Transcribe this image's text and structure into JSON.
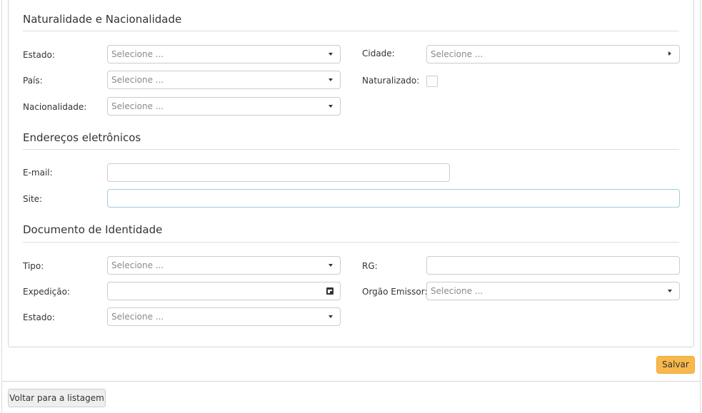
{
  "naturalidade": {
    "title": "Naturalidade e Nacionalidade",
    "estado": {
      "label": "Estado:",
      "placeholder": "Selecione ..."
    },
    "pais": {
      "label": "País:",
      "placeholder": "Selecione ..."
    },
    "nacionalidade": {
      "label": "Nacionalidade:",
      "placeholder": "Selecione ..."
    },
    "cidade": {
      "label": "Cidade:",
      "placeholder": "Selecione ..."
    },
    "naturalizado": {
      "label": "Naturalizado:",
      "checked": false
    }
  },
  "enderecos": {
    "title": "Endereços eletrônicos",
    "email": {
      "label": "E-mail:",
      "value": ""
    },
    "site": {
      "label": "Site:",
      "value": ""
    }
  },
  "documento": {
    "title": "Documento de Identidade",
    "tipo": {
      "label": "Tipo:",
      "placeholder": "Selecione ..."
    },
    "expedicao": {
      "label": "Expedição:",
      "value": ""
    },
    "estado": {
      "label": "Estado:",
      "placeholder": "Selecione ..."
    },
    "rg": {
      "label": "RG:",
      "value": ""
    },
    "orgao_emissor": {
      "label": "Orgão Emissor:",
      "placeholder": "Selecione ..."
    }
  },
  "actions": {
    "save_label": "Salvar",
    "back_label": "Voltar para a listagem"
  },
  "colors": {
    "save_button": "#f8b84b",
    "focus_border": "#9ecfd9"
  },
  "icons": {
    "select_caret": "chevron-down-icon",
    "cidade_caret": "chevron-right-icon",
    "date_picker": "calendar-icon"
  }
}
